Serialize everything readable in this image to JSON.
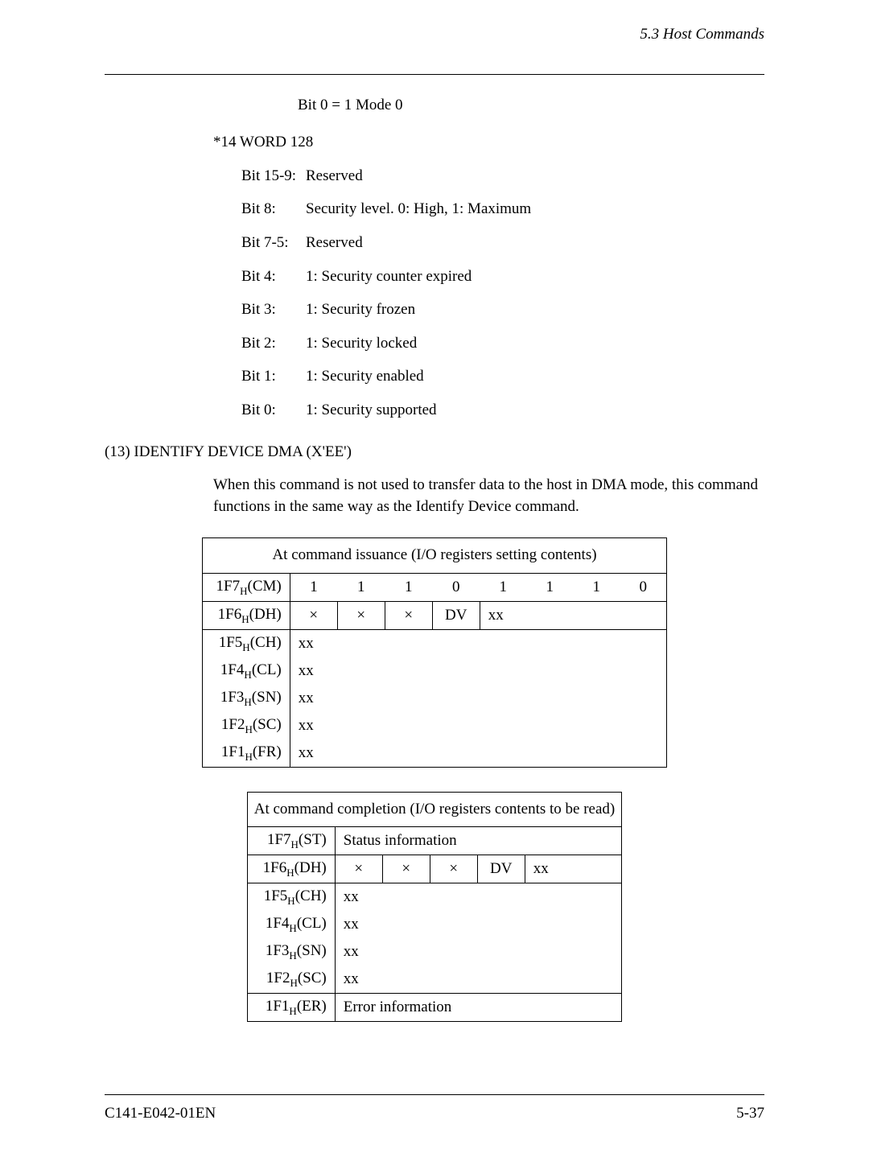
{
  "header": {
    "section": "5.3  Host Commands"
  },
  "mode_line": "Bit 0 = 1  Mode 0",
  "word128_heading": "*14 WORD 128",
  "bits": [
    {
      "label": "Bit 15-9:",
      "desc": "Reserved"
    },
    {
      "label": "Bit 8:",
      "desc": "Security level.  0:  High, 1:  Maximum"
    },
    {
      "label": "Bit 7-5:",
      "desc": "Reserved"
    },
    {
      "label": "Bit 4:",
      "desc": "1:  Security counter expired"
    },
    {
      "label": "Bit 3:",
      "desc": "1:  Security frozen"
    },
    {
      "label": "Bit 2:",
      "desc": "1:  Security locked"
    },
    {
      "label": "Bit 1:",
      "desc": "1:  Security enabled"
    },
    {
      "label": "Bit 0:",
      "desc": "1:  Security supported"
    }
  ],
  "section_heading": "(13)  IDENTIFY DEVICE DMA (X'EE')",
  "paragraph": "When this command is not used to transfer data to the host in DMA mode, this command functions in the same way as the Identify Device command.",
  "table1": {
    "caption": "At command issuance (I/O registers setting contents)",
    "rows": [
      {
        "reg": "1F7",
        "suf": "(CM)",
        "cells": [
          "1",
          "1",
          "1",
          "0",
          "1",
          "1",
          "1",
          "0"
        ],
        "type": "bits"
      },
      {
        "reg": "1F6",
        "suf": "(DH)",
        "cells": [
          "×",
          "×",
          "×",
          "DV",
          "xx",
          "",
          "",
          ""
        ],
        "type": "dh"
      },
      {
        "reg": "1F5",
        "suf": "(CH)",
        "full": "xx",
        "type": "full"
      },
      {
        "reg": "1F4",
        "suf": "(CL)",
        "full": "xx",
        "type": "full"
      },
      {
        "reg": "1F3",
        "suf": "(SN)",
        "full": "xx",
        "type": "full"
      },
      {
        "reg": "1F2",
        "suf": "(SC)",
        "full": "xx",
        "type": "full"
      },
      {
        "reg": "1F1",
        "suf": "(FR)",
        "full": "xx",
        "type": "full"
      }
    ]
  },
  "table2": {
    "caption": "At command completion (I/O registers contents to be read)",
    "rows": [
      {
        "reg": "1F7",
        "suf": "(ST)",
        "full": "Status information",
        "type": "full"
      },
      {
        "reg": "1F6",
        "suf": "(DH)",
        "cells": [
          "×",
          "×",
          "×",
          "DV",
          "xx",
          "",
          "",
          ""
        ],
        "type": "dh"
      },
      {
        "reg": "1F5",
        "suf": "(CH)",
        "full": "xx",
        "type": "full"
      },
      {
        "reg": "1F4",
        "suf": "(CL)",
        "full": "xx",
        "type": "full"
      },
      {
        "reg": "1F3",
        "suf": "(SN)",
        "full": "xx",
        "type": "full"
      },
      {
        "reg": "1F2",
        "suf": "(SC)",
        "full": "xx",
        "type": "full"
      },
      {
        "reg": "1F1",
        "suf": "(ER)",
        "full": "Error information",
        "type": "full"
      }
    ]
  },
  "footer": {
    "left": "C141-E042-01EN",
    "right": "5-37"
  }
}
